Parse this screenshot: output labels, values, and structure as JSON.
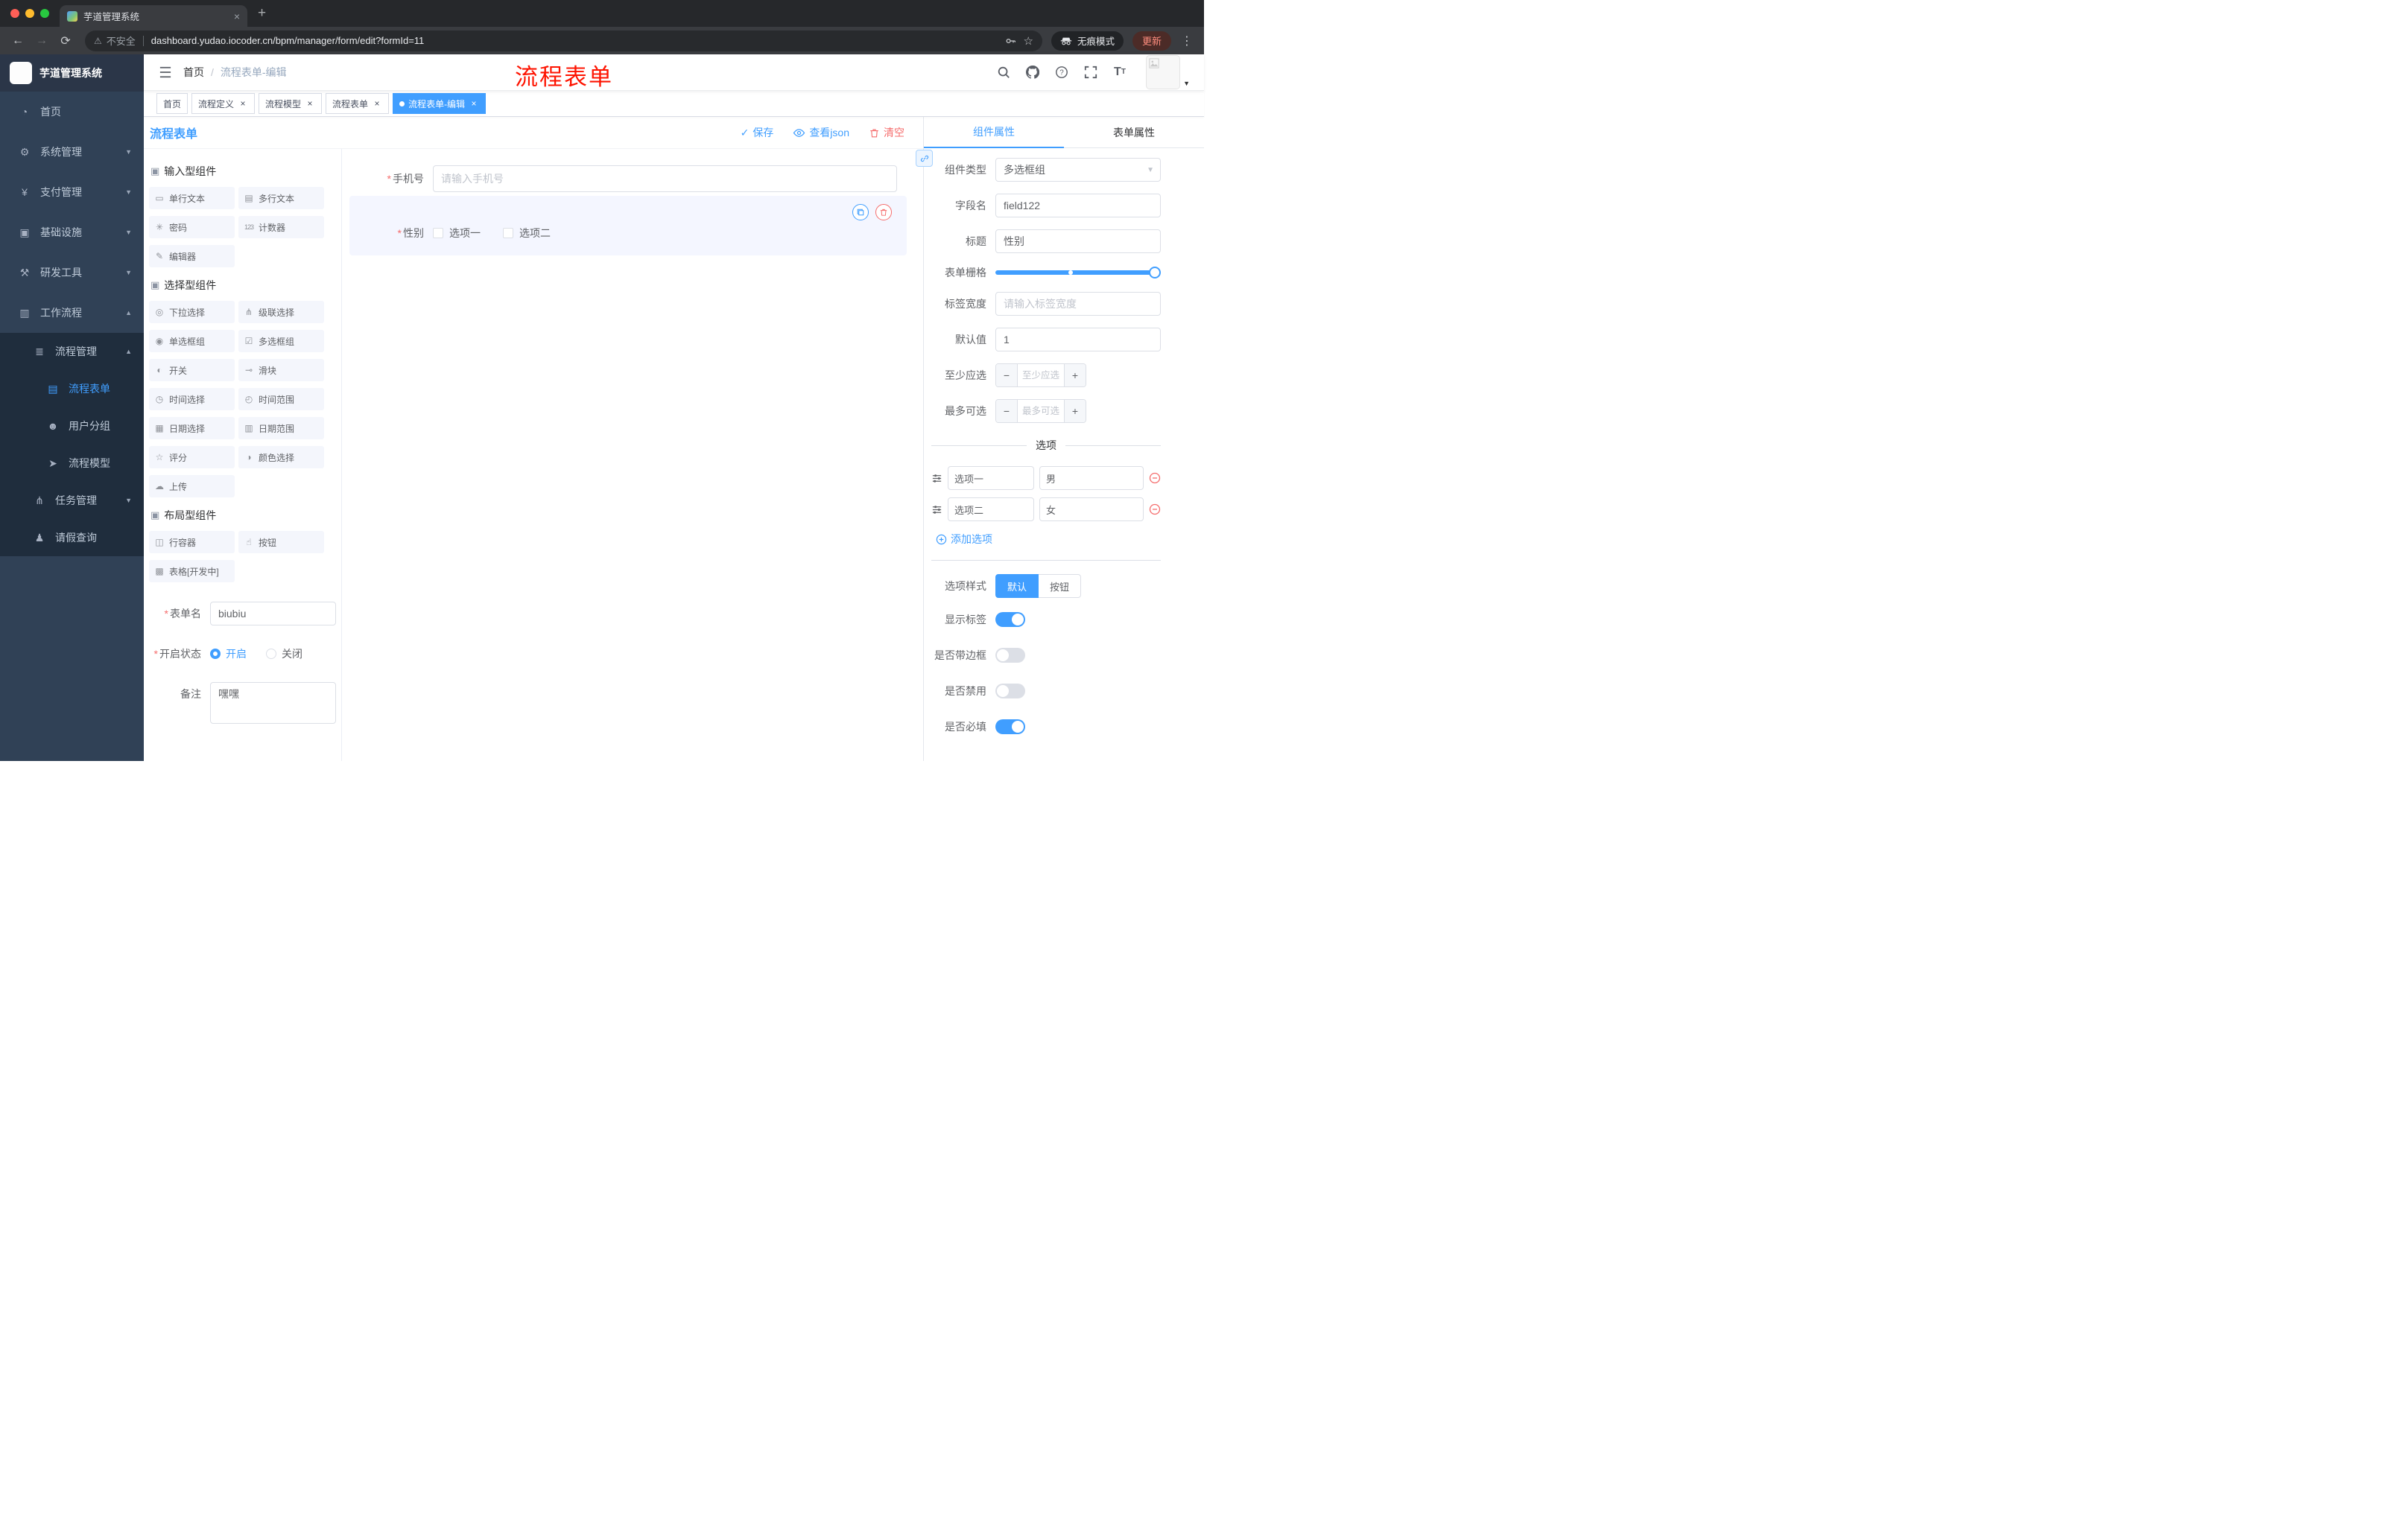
{
  "browser": {
    "tab_title": "芋道管理系统",
    "security_label": "不安全",
    "url": "dashboard.yudao.iocoder.cn/bpm/manager/form/edit?formId=11",
    "incognito_label": "无痕模式",
    "update_label": "更新"
  },
  "annotation": {
    "text": "流程表单",
    "color": "#fe1300"
  },
  "sidebar": {
    "logo_title": "芋道管理系统",
    "menu": [
      {
        "label": "首页"
      },
      {
        "label": "系统管理"
      },
      {
        "label": "支付管理"
      },
      {
        "label": "基础设施"
      },
      {
        "label": "研发工具"
      },
      {
        "label": "工作流程"
      },
      {
        "label": "流程管理"
      },
      {
        "label": "流程表单"
      },
      {
        "label": "用户分组"
      },
      {
        "label": "流程模型"
      },
      {
        "label": "任务管理"
      },
      {
        "label": "请假查询"
      }
    ]
  },
  "header": {
    "breadcrumb_home": "首页",
    "breadcrumb_current": "流程表单-编辑"
  },
  "tags": [
    {
      "label": "首页"
    },
    {
      "label": "流程定义"
    },
    {
      "label": "流程模型"
    },
    {
      "label": "流程表单"
    },
    {
      "label": "流程表单-编辑"
    }
  ],
  "builder": {
    "panel_title": "流程表单",
    "toolbar": {
      "save": "保存",
      "view_json": "查看json",
      "clear": "清空"
    },
    "palette": {
      "section_input": "输入型组件",
      "section_select": "选择型组件",
      "section_layout": "布局型组件",
      "input_items": [
        "单行文本",
        "多行文本",
        "密码",
        "计数器",
        "编辑器"
      ],
      "select_items": [
        "下拉选择",
        "级联选择",
        "单选框组",
        "多选框组",
        "开关",
        "滑块",
        "时间选择",
        "时间范围",
        "日期选择",
        "日期范围",
        "评分",
        "颜色选择",
        "上传"
      ],
      "layout_items": [
        "行容器",
        "按钮",
        "表格[开发中]"
      ]
    },
    "meta": {
      "form_name_label": "表单名",
      "form_name_value": "biubiu",
      "status_label": "开启状态",
      "status_on": "开启",
      "status_off": "关闭",
      "remark_label": "备注",
      "remark_value": "嘿嘿"
    },
    "canvas": {
      "phone_label": "手机号",
      "phone_placeholder": "请输入手机号",
      "gender_label": "性别",
      "gender_options": [
        "选项一",
        "选项二"
      ]
    }
  },
  "props": {
    "tab_component": "组件属性",
    "tab_form": "表单属性",
    "component_type_label": "组件类型",
    "component_type_value": "多选框组",
    "field_name_label": "字段名",
    "field_name_value": "field122",
    "title_label": "标题",
    "title_value": "性别",
    "grid_label": "表单栅格",
    "label_width_label": "标签宽度",
    "label_width_placeholder": "请输入标签宽度",
    "default_label": "默认值",
    "default_value": "1",
    "min_select_label": "至少应选",
    "min_select_placeholder": "至少应选",
    "max_select_label": "最多可选",
    "max_select_placeholder": "最多可选",
    "options_title": "选项",
    "options": [
      {
        "label": "选项一",
        "value": "男"
      },
      {
        "label": "选项二",
        "value": "女"
      }
    ],
    "add_option": "添加选项",
    "style_label": "选项样式",
    "style_default": "默认",
    "style_button": "按钮",
    "toggles": [
      {
        "label": "显示标签",
        "on": true
      },
      {
        "label": "是否带边框",
        "on": false
      },
      {
        "label": "是否禁用",
        "on": false
      },
      {
        "label": "是否必填",
        "on": true
      }
    ],
    "accent_color": "#409eff"
  }
}
